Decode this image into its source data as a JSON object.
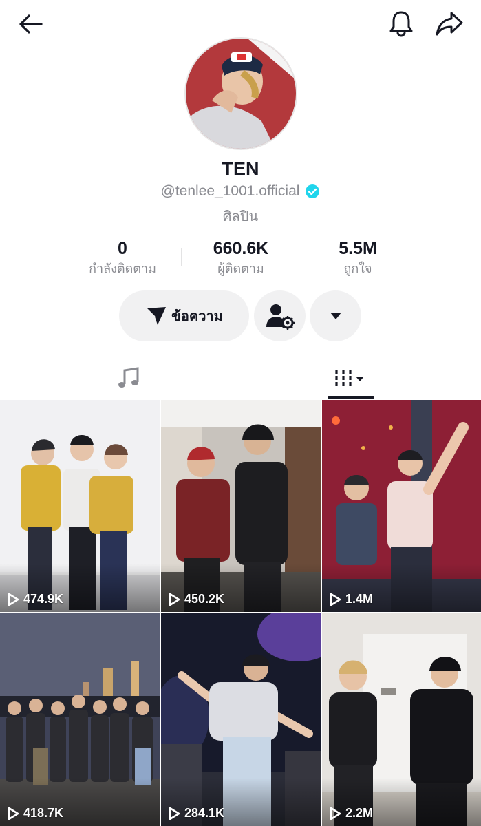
{
  "profile": {
    "name": "TEN",
    "handle": "@tenlee_1001.official",
    "category": "ศิลปิน"
  },
  "stats": [
    {
      "value": "0",
      "label": "กำลังติดตาม"
    },
    {
      "value": "660.6K",
      "label": "ผู้ติดตาม"
    },
    {
      "value": "5.5M",
      "label": "ถูกใจ"
    }
  ],
  "actions": {
    "message_label": "ข้อความ"
  },
  "icons": {
    "back": "back-arrow-icon",
    "notifications": "bell-icon",
    "share": "share-icon",
    "verified": "verified-badge-icon",
    "message": "send-icon",
    "add_friend": "user-settings-icon",
    "more": "dropdown-arrow-icon",
    "music_tab": "music-note-icon",
    "videos_tab": "video-grid-icon",
    "play": "play-icon"
  },
  "colors": {
    "verified": "#20d5ec",
    "text_primary": "#161823",
    "text_secondary": "#8a8b91",
    "button_bg": "#f1f1f2"
  },
  "videos": [
    {
      "views": "474.9K"
    },
    {
      "views": "450.2K"
    },
    {
      "views": "1.4M"
    },
    {
      "views": "418.7K"
    },
    {
      "views": "284.1K"
    },
    {
      "views": "2.2M"
    }
  ]
}
